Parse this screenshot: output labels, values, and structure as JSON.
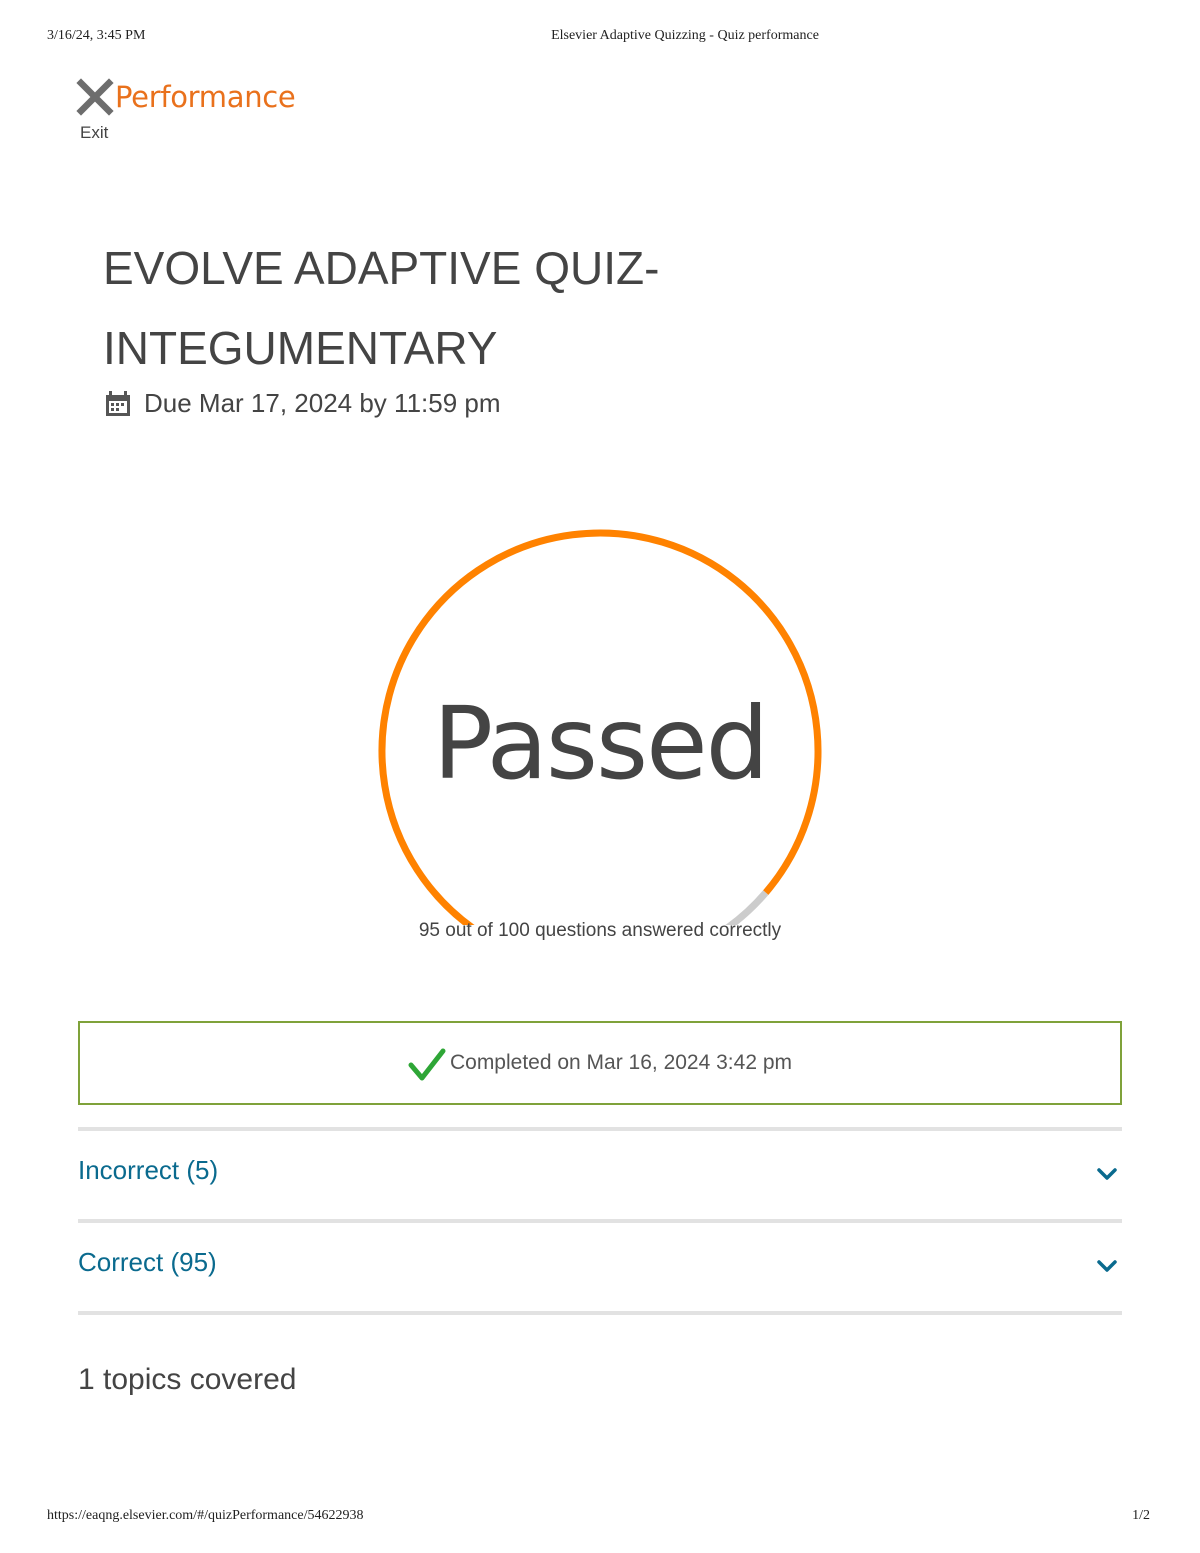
{
  "print_header": {
    "datetime": "3/16/24, 3:45 PM",
    "page_title": "Elsevier Adaptive Quizzing - Quiz performance"
  },
  "print_footer": {
    "url": "https://eaqng.elsevier.com/#/quizPerformance/54622938",
    "page_number": "1/2"
  },
  "header": {
    "exit_icon": "close-x-icon",
    "exit_label": "Exit",
    "heading": "Performance"
  },
  "quiz": {
    "title_line1": "EVOLVE ADAPTIVE QUIZ-",
    "title_line2": "INTEGUMENTARY",
    "due_icon": "calendar-icon",
    "due_text": "Due Mar 17, 2024 by 11:59 pm"
  },
  "result": {
    "status": "Passed",
    "correct": 95,
    "total": 100,
    "caption": "95 out of 100 questions answered correctly",
    "colors": {
      "progress": "#ff8200",
      "remaining": "#cccccc"
    }
  },
  "completion": {
    "icon": "checkmark-icon",
    "text": "Completed on Mar 16, 2024 3:42 pm",
    "border_color": "#7fa23a"
  },
  "sections": [
    {
      "label": "Incorrect (5)",
      "icon": "chevron-down-icon"
    },
    {
      "label": "Correct (95)",
      "icon": "chevron-down-icon"
    }
  ],
  "topics_summary": "1 topics covered",
  "colors": {
    "accent": "#e9711c",
    "link": "#0a6a8e"
  }
}
